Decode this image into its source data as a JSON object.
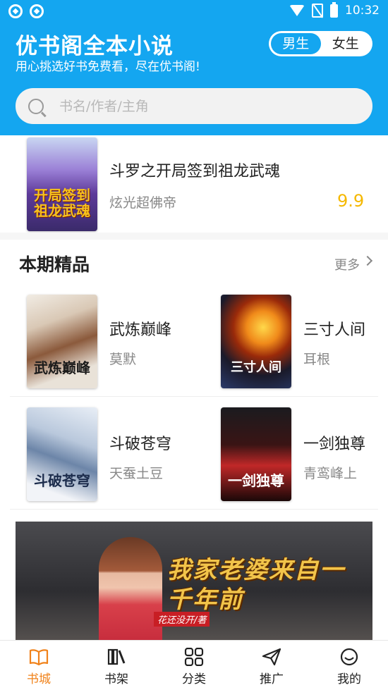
{
  "status_bar": {
    "time": "10:32"
  },
  "header": {
    "title": "优书阁全本小说",
    "subtitle": "用心挑选好书免费看，尽在优书阁!",
    "gender_tabs": [
      {
        "label": "男生",
        "active": true
      },
      {
        "label": "女生",
        "active": false
      }
    ]
  },
  "search": {
    "placeholder": "书名/作者/主角"
  },
  "top_book": {
    "title": "斗罗之开局签到祖龙武魂",
    "author": "炫光超佛帝",
    "score": "9.9",
    "cover_text": "开局签到祖龙武魂"
  },
  "section": {
    "title": "本期精品",
    "more": "更多"
  },
  "books": [
    {
      "title": "武炼巅峰",
      "author": "莫默",
      "cover_text": "武炼巅峰"
    },
    {
      "title": "三寸人间",
      "author": "耳根",
      "cover_text": "三寸人间"
    },
    {
      "title": "斗破苍穹",
      "author": "天蚕土豆",
      "cover_text": "斗破苍穹"
    },
    {
      "title": "一剑独尊",
      "author": "青鸾峰上",
      "cover_text": "一剑独尊"
    }
  ],
  "banner": {
    "title": "我家老婆来自一千年前",
    "author": "花还没开/著"
  },
  "tabs": [
    {
      "label": "书城",
      "icon": "open-book-icon",
      "active": true
    },
    {
      "label": "书架",
      "icon": "bookshelf-icon",
      "active": false
    },
    {
      "label": "分类",
      "icon": "category-grid-icon",
      "active": false
    },
    {
      "label": "推广",
      "icon": "paper-plane-icon",
      "active": false
    },
    {
      "label": "我的",
      "icon": "smiley-face-icon",
      "active": false
    }
  ],
  "colors": {
    "primary": "#14a6f0",
    "active_tab": "#f0821a",
    "score": "#f5b800"
  }
}
